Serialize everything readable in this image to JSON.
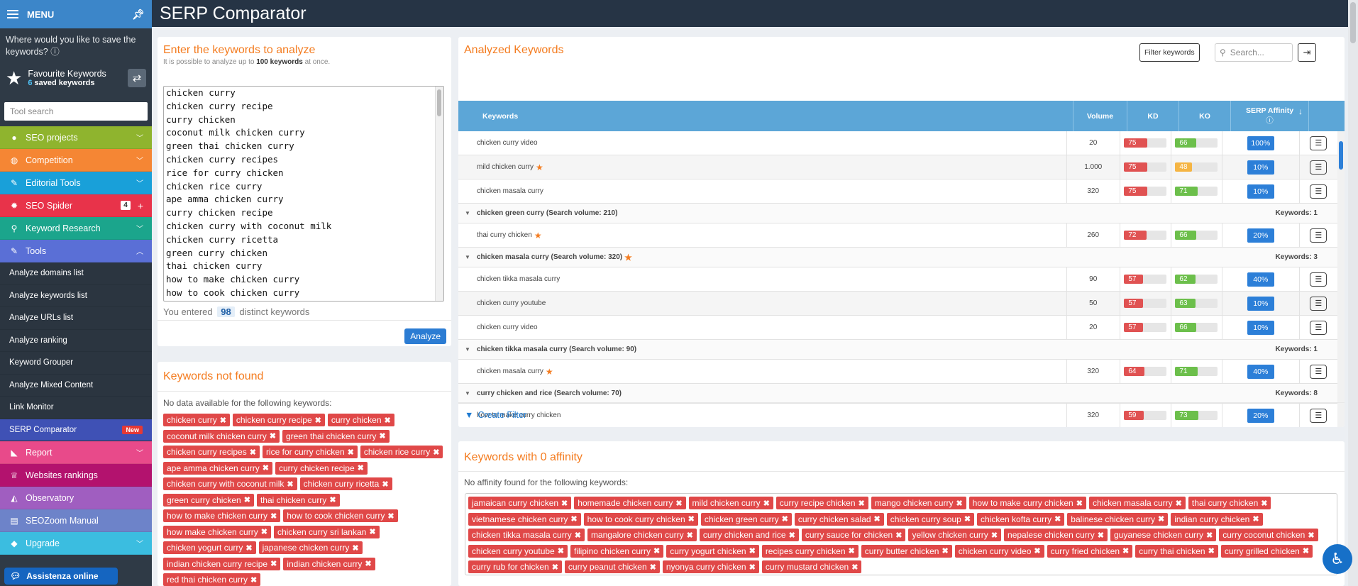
{
  "sidebar": {
    "menu_label": "MENU",
    "save_question": "Where would you like to save the keywords? ⓘ",
    "favourite_title": "Favourite Keywords",
    "favourite_count": "6",
    "favourite_suffix": " saved keywords",
    "tool_search_placeholder": "Tool search",
    "nav": [
      {
        "label": "SEO projects",
        "color": "#8fb42e",
        "icon": "●"
      },
      {
        "label": "Competition",
        "color": "#f58634",
        "icon": "◍"
      },
      {
        "label": "Editorial Tools",
        "color": "#19a0d9",
        "icon": "✎"
      },
      {
        "label": "SEO Spider",
        "color": "#e8334a",
        "icon": "✹",
        "badge": "4"
      },
      {
        "label": "Keyword Research",
        "color": "#1ba58c",
        "icon": "⚲"
      },
      {
        "label": "Tools",
        "color": "#5a6fd6",
        "icon": "✎"
      }
    ],
    "tools_sub": [
      "Analyze domains list",
      "Analyze keywords list",
      "Analyze URLs list",
      "Analyze ranking",
      "Keyword Grouper",
      "Analyze Mixed Content",
      "Link Monitor",
      "SERP Comparator"
    ],
    "new_badge": "New",
    "nav_bottom": [
      {
        "label": "Report",
        "color": "#e84a8a",
        "icon": "◣"
      },
      {
        "label": "Websites rankings",
        "color": "#b3126e",
        "icon": "♕"
      },
      {
        "label": "Observatory",
        "color": "#a05ec0",
        "icon": "◭"
      },
      {
        "label": "SEOZoom Manual",
        "color": "#6d83c9",
        "icon": "▤"
      },
      {
        "label": "Upgrade",
        "color": "#3bbde0",
        "icon": "◆"
      }
    ],
    "assist_label": "Assistenza online"
  },
  "page_title": "SERP Comparator",
  "input_panel": {
    "title": "Enter the keywords to analyze",
    "subtitle_pre": "It is possible to analyze up to ",
    "subtitle_bold": "100 keywords",
    "subtitle_post": " at once.",
    "keywords": [
      "chicken curry",
      "chicken curry recipe",
      "curry chicken",
      "coconut milk chicken curry",
      "green thai chicken curry",
      "chicken curry recipes",
      "rice for curry chicken",
      "chicken rice curry",
      "ape amma chicken curry",
      "curry chicken recipe",
      "chicken curry with coconut milk",
      "chicken curry ricetta",
      "green curry chicken",
      "thai chicken curry",
      "how to make chicken curry",
      "how to cook chicken curry"
    ],
    "entered_pre": "You entered",
    "entered_count": "98",
    "entered_post": "distinct keywords",
    "analyze_label": "Analyze"
  },
  "not_found": {
    "title": "Keywords not found",
    "note": "No data available for the following keywords:",
    "tags": [
      "chicken curry",
      "chicken curry recipe",
      "curry chicken",
      "coconut milk chicken curry",
      "green thai chicken curry",
      "chicken curry recipes",
      "rice for curry chicken",
      "chicken rice curry",
      "ape amma chicken curry",
      "curry chicken recipe",
      "chicken curry with coconut milk",
      "chicken curry ricetta",
      "green curry chicken",
      "thai chicken curry",
      "how to make chicken curry",
      "how to cook chicken curry",
      "how make chicken curry",
      "chicken curry sri lankan",
      "chicken yogurt curry",
      "japanese chicken curry",
      "indian chicken curry recipe",
      "indian chicken curry",
      "red thai chicken curry"
    ]
  },
  "analyzed": {
    "title": "Analyzed Keywords",
    "filter_label": "Filter keywords",
    "search_placeholder": "Search...",
    "headers": {
      "keywords": "Keywords",
      "volume": "Volume",
      "kd": "KD",
      "ko": "KO",
      "affinity": "SERP Affinity",
      "affinity_info": "ⓘ"
    },
    "rows": [
      {
        "type": "row",
        "kw": "chicken curry video",
        "star": false,
        "vol": "20",
        "kd": "75",
        "kd_pct": 0.75,
        "kd_color": "#e05252",
        "ko": "66",
        "ko_pct": 0.66,
        "ko_color": "#6cbf4b",
        "aff": "100%"
      },
      {
        "type": "row",
        "kw": "mild chicken curry",
        "star": true,
        "vol": "1.000",
        "kd": "75",
        "kd_pct": 0.75,
        "kd_color": "#e05252",
        "ko": "48",
        "ko_pct": 0.48,
        "ko_color": "#f5b544",
        "aff": "10%"
      },
      {
        "type": "row",
        "kw": "chicken masala curry",
        "star": false,
        "vol": "320",
        "kd": "75",
        "kd_pct": 0.75,
        "kd_color": "#e05252",
        "ko": "71",
        "ko_pct": 0.71,
        "ko_color": "#6cbf4b",
        "aff": "10%"
      },
      {
        "type": "group",
        "kw": "chicken green curry (Search volume: 210)",
        "star": false,
        "count": "Keywords: 1"
      },
      {
        "type": "row",
        "kw": "thai curry chicken",
        "star": true,
        "vol": "260",
        "kd": "72",
        "kd_pct": 0.72,
        "kd_color": "#e05252",
        "ko": "66",
        "ko_pct": 0.66,
        "ko_color": "#6cbf4b",
        "aff": "20%"
      },
      {
        "type": "group",
        "kw": "chicken masala curry (Search volume: 320)",
        "star": true,
        "count": "Keywords: 3"
      },
      {
        "type": "row",
        "kw": "chicken tikka masala curry",
        "star": false,
        "vol": "90",
        "kd": "57",
        "kd_pct": 0.57,
        "kd_color": "#e05252",
        "ko": "62",
        "ko_pct": 0.62,
        "ko_color": "#6cbf4b",
        "aff": "40%"
      },
      {
        "type": "row",
        "kw": "chicken curry youtube",
        "star": false,
        "vol": "50",
        "kd": "57",
        "kd_pct": 0.57,
        "kd_color": "#e05252",
        "ko": "63",
        "ko_pct": 0.63,
        "ko_color": "#6cbf4b",
        "aff": "10%"
      },
      {
        "type": "row",
        "kw": "chicken curry video",
        "star": false,
        "vol": "20",
        "kd": "57",
        "kd_pct": 0.57,
        "kd_color": "#e05252",
        "ko": "66",
        "ko_pct": 0.66,
        "ko_color": "#6cbf4b",
        "aff": "10%"
      },
      {
        "type": "group",
        "kw": "chicken tikka masala curry (Search volume: 90)",
        "star": false,
        "count": "Keywords: 1"
      },
      {
        "type": "row",
        "kw": "chicken masala curry",
        "star": true,
        "vol": "320",
        "kd": "64",
        "kd_pct": 0.64,
        "kd_color": "#e05252",
        "ko": "71",
        "ko_pct": 0.71,
        "ko_color": "#6cbf4b",
        "aff": "40%"
      },
      {
        "type": "group",
        "kw": "curry chicken and rice (Search volume: 70)",
        "star": false,
        "count": "Keywords: 8"
      },
      {
        "type": "row",
        "kw": "how to make curry chicken",
        "star": false,
        "vol": "320",
        "kd": "59",
        "kd_pct": 0.59,
        "kd_color": "#e05252",
        "ko": "73",
        "ko_pct": 0.73,
        "ko_color": "#6cbf4b",
        "aff": "20%"
      }
    ],
    "create_filter": "Create Filter"
  },
  "zero_affinity": {
    "title": "Keywords with 0 affinity",
    "note": "No affinity found for the following keywords:",
    "tags": [
      "jamaican curry chicken",
      "homemade chicken curry",
      "mild chicken curry",
      "curry recipe chicken",
      "mango chicken curry",
      "how to make curry chicken",
      "chicken masala curry",
      "thai curry chicken",
      "vietnamese chicken curry",
      "how to cook curry chicken",
      "chicken green curry",
      "curry chicken salad",
      "chicken curry soup",
      "chicken kofta curry",
      "balinese chicken curry",
      "indian curry chicken",
      "chicken tikka masala curry",
      "mangalore chicken curry",
      "curry chicken and rice",
      "curry sauce for chicken",
      "yellow chicken curry",
      "nepalese chicken curry",
      "guyanese chicken curry",
      "curry coconut chicken",
      "chicken curry youtube",
      "filipino chicken curry",
      "curry yogurt chicken",
      "recipes curry chicken",
      "curry butter chicken",
      "chicken curry video",
      "curry fried chicken",
      "curry thai chicken",
      "curry grilled chicken",
      "curry rub for chicken",
      "curry peanut chicken",
      "nyonya curry chicken",
      "curry mustard chicken"
    ]
  }
}
